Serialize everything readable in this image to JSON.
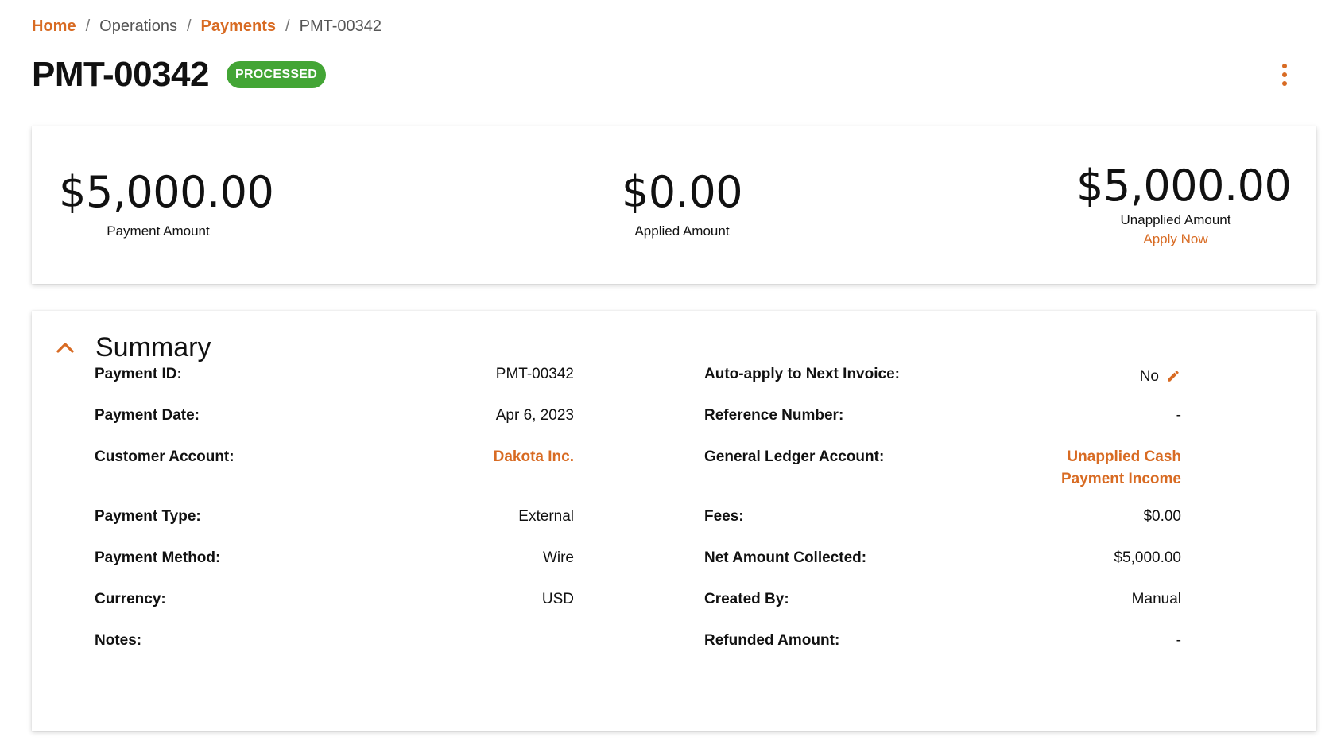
{
  "breadcrumb": {
    "items": [
      {
        "label": "Home",
        "link": true
      },
      {
        "label": "Operations",
        "link": false
      },
      {
        "label": "Payments",
        "link": true
      },
      {
        "label": "PMT-00342",
        "link": false
      }
    ],
    "separator": "/"
  },
  "header": {
    "title": "PMT-00342",
    "status": "PROCESSED",
    "more_icon": "more-vertical-icon"
  },
  "amounts": {
    "payment": {
      "value": "$5,000.00",
      "label": "Payment Amount"
    },
    "applied": {
      "value": "$0.00",
      "label": "Applied Amount"
    },
    "unapplied": {
      "value": "$5,000.00",
      "label": "Unapplied Amount",
      "action": "Apply Now"
    }
  },
  "summary": {
    "title": "Summary",
    "toggle_icon": "chevron-up-icon",
    "left": [
      {
        "label": "Payment ID:",
        "value": "PMT-00342"
      },
      {
        "label": "Payment Date:",
        "value": "Apr 6, 2023"
      },
      {
        "label": "Customer Account:",
        "value": "Dakota Inc."
      },
      {
        "label": "Payment Type:",
        "value": "External"
      },
      {
        "label": "Payment Method:",
        "value": "Wire"
      },
      {
        "label": "Currency:",
        "value": "USD"
      },
      {
        "label": "Notes:",
        "value": ""
      }
    ],
    "right": [
      {
        "label": "Auto-apply to Next Invoice:",
        "value": "No"
      },
      {
        "label": "Reference Number:",
        "value": "-"
      },
      {
        "label": "General Ledger Account:",
        "value_line1": "Unapplied Cash",
        "value_line2": "Payment Income"
      },
      {
        "label": "Fees:",
        "value": "$0.00"
      },
      {
        "label": "Net Amount Collected:",
        "value": "$5,000.00"
      },
      {
        "label": "Created By:",
        "value": "Manual"
      },
      {
        "label": "Refunded Amount:",
        "value": "-"
      }
    ],
    "edit_icon": "pencil-icon"
  },
  "colors": {
    "accent": "#d86b23",
    "success": "#43a535"
  }
}
